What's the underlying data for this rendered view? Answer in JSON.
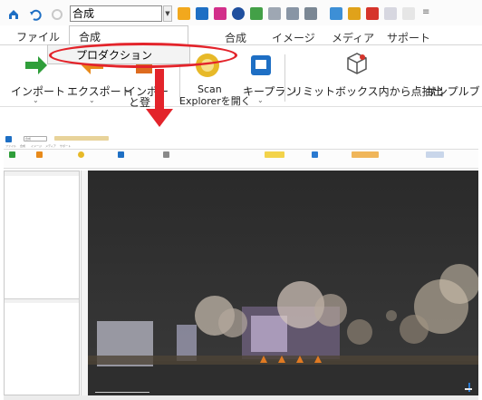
{
  "top": {
    "combo_value": "合成",
    "combo_arrow": "▼",
    "file_tab": "ファイル",
    "active_tab": "合成",
    "tabs": [
      "合成",
      "イメージ",
      "メディア",
      "サポート"
    ],
    "dropdown_item": "プロダクション",
    "ribbon": {
      "import": "インポート",
      "export": "エクスポート",
      "import_reg_line1": "インポー",
      "import_reg_line2": "と登",
      "scan_line1": "Scan",
      "scan_line2": "Explorerを開く",
      "keyplan": "キープラン",
      "limitbox": "リミットボックス内から点抽出",
      "sample": "サンプルブ"
    },
    "chevron": "⌄"
  },
  "app": {
    "title": "合成",
    "ribbon_tabs": [
      "ファイル",
      "合成",
      "イメージ",
      "メディア",
      "サポート"
    ]
  },
  "colors": {
    "accent_red": "#e3242b",
    "viewport_bg": "#303030",
    "import_green": "#2f9e3a",
    "export_orange": "#e88a1a",
    "keyplan_blue": "#1e6fc4",
    "scan_yellow": "#e7b928"
  }
}
